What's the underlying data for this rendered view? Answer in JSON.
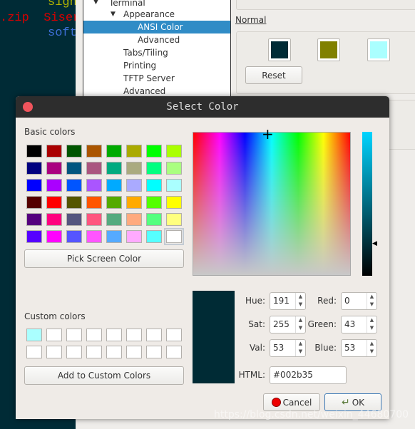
{
  "terminal": {
    "lines": [
      {
        "text": "signa",
        "color": "#b5b500"
      },
      {
        "text": ".zip  Siser",
        "color": "#d70000"
      },
      {
        "text": "softw",
        "color": "#3d6fd6"
      }
    ]
  },
  "tree": {
    "items": [
      "Terminal",
      "Appearance",
      "ANSI Color",
      "Advanced",
      "Tabs/Tiling",
      "Printing",
      "TFTP Server",
      "Advanced"
    ],
    "selected": "ANSI Color"
  },
  "ansi": {
    "group_label": "Normal",
    "swatches": [
      "#002b36",
      "#808000",
      "#aaffff"
    ],
    "reset_label": "Reset"
  },
  "dialog": {
    "title": "Select Color",
    "basic_colors_label": "Basic colors",
    "basic_colors": [
      "#000000",
      "#aa0000",
      "#005500",
      "#aa5500",
      "#00aa00",
      "#aaaa00",
      "#00ff00",
      "#aaff00",
      "#00007f",
      "#aa007f",
      "#00557f",
      "#aa557f",
      "#00aa7f",
      "#aaaa7f",
      "#00ff7f",
      "#aaff7f",
      "#0000ff",
      "#aa00ff",
      "#0055ff",
      "#aa55ff",
      "#00aaff",
      "#aaaaff",
      "#00ffff",
      "#aaffff",
      "#550000",
      "#ff0000",
      "#555500",
      "#ff5500",
      "#55aa00",
      "#ffaa00",
      "#55ff00",
      "#ffff00",
      "#55007f",
      "#ff007f",
      "#55557f",
      "#ff557f",
      "#55aa7f",
      "#ffaa7f",
      "#55ff7f",
      "#ffff7f",
      "#5500ff",
      "#ff00ff",
      "#5555ff",
      "#ff55ff",
      "#55aaff",
      "#ffaaff",
      "#55ffff",
      "#ffffff"
    ],
    "pick_screen_label": "Pick Screen Color",
    "custom_colors_label": "Custom colors",
    "custom_colors": [
      "#aaffff",
      "#ffffff",
      "#ffffff",
      "#ffffff",
      "#ffffff",
      "#ffffff",
      "#ffffff",
      "#ffffff",
      "#ffffff",
      "#ffffff",
      "#ffffff",
      "#ffffff",
      "#ffffff",
      "#ffffff",
      "#ffffff",
      "#ffffff"
    ],
    "add_custom_label": "Add to Custom Colors",
    "current_color": "#002b35",
    "fields": {
      "hue": {
        "label": "Hue:",
        "value": "191"
      },
      "sat": {
        "label": "Sat:",
        "value": "255"
      },
      "val": {
        "label": "Val:",
        "value": "53"
      },
      "red": {
        "label": "Red:",
        "value": "0"
      },
      "green": {
        "label": "Green:",
        "value": "43"
      },
      "blue": {
        "label": "Blue:",
        "value": "53"
      }
    },
    "html_label": "HTML:",
    "html_value": "#002b35",
    "cancel_label": "Cancel",
    "ok_label": "OK"
  },
  "watermark": "https://blog.csdn.net/weixin_44680700"
}
